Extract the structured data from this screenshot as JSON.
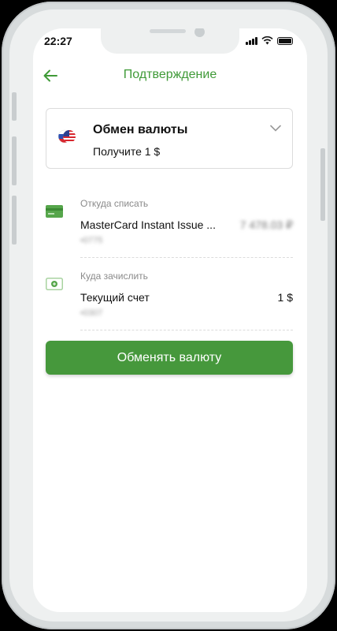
{
  "status_bar": {
    "time": "22:27"
  },
  "header": {
    "title": "Подтверждение"
  },
  "exchange_card": {
    "title": "Обмен валюты",
    "subtitle": "Получите 1 $",
    "icon": "flags-usd-rub-icon"
  },
  "source_account": {
    "label": "Откуда списать",
    "name": "MasterCard Instant Issue ...",
    "amount": "7 478.03 ₽",
    "number": "•0775"
  },
  "destination_account": {
    "label": "Куда зачислить",
    "name": "Текущий счет",
    "amount": "1 $",
    "number": "•0307"
  },
  "actions": {
    "exchange_button": "Обменять валюту"
  },
  "colors": {
    "accent": "#46983c",
    "title_green": "#3f9a37",
    "divider": "#dcdcdc"
  }
}
